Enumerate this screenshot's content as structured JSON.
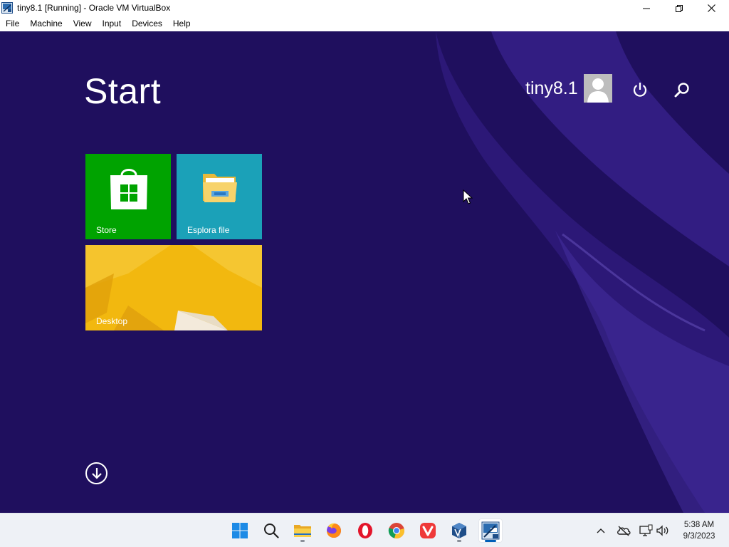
{
  "window": {
    "title": "tiny8.1 [Running] - Oracle VM VirtualBox",
    "app_icon": "virtualbox-vm-icon",
    "controls": [
      "minimize-icon",
      "maximize-icon",
      "close-icon"
    ]
  },
  "menubar": {
    "items": [
      {
        "label": "File"
      },
      {
        "label": "Machine"
      },
      {
        "label": "View"
      },
      {
        "label": "Input"
      },
      {
        "label": "Devices"
      },
      {
        "label": "Help"
      }
    ]
  },
  "guest": {
    "background_color": "#1f0f5e",
    "start_title": "Start",
    "user": {
      "name": "tiny8.1",
      "avatar_icon": "user-avatar-icon"
    },
    "header_icons": [
      "power-icon",
      "search-icon"
    ],
    "tiles": {
      "store": {
        "label": "Store",
        "color": "#00a300",
        "icon": "store-bag-icon"
      },
      "files": {
        "label": "Esplora file",
        "color": "#1ba1b8",
        "icon": "file-explorer-icon"
      },
      "desktop": {
        "label": "Desktop",
        "color": "#f2b80f"
      }
    },
    "all_apps_icon": "arrow-down-circle-icon"
  },
  "taskbar": {
    "pinned": [
      {
        "name": "start-button",
        "icon": "windows-logo-icon"
      },
      {
        "name": "search-button",
        "icon": "search-icon"
      },
      {
        "name": "file-explorer",
        "icon": "folder-icon",
        "running": true
      },
      {
        "name": "firefox",
        "icon": "firefox-icon"
      },
      {
        "name": "opera",
        "icon": "opera-icon"
      },
      {
        "name": "chrome",
        "icon": "chrome-icon"
      },
      {
        "name": "vivaldi",
        "icon": "vivaldi-icon"
      },
      {
        "name": "virtualbox-manager",
        "icon": "virtualbox-icon",
        "running": true
      },
      {
        "name": "tiny8-vm-window",
        "icon": "virtualbox-vm-icon",
        "running": true,
        "active": true
      }
    ],
    "tray": [
      "chevron-up-icon",
      "onedrive-offline-icon",
      "network-icon",
      "volume-icon"
    ],
    "clock": {
      "time": "5:38 AM",
      "date": "9/3/2023"
    }
  }
}
